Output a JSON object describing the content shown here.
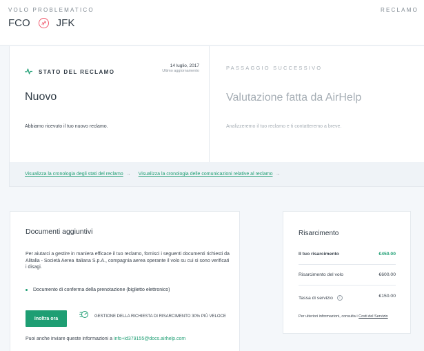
{
  "header": {
    "eyebrow": "VOLO PROBLEMATICO",
    "right_label": "RECLAMO",
    "origin": "FCO",
    "destination": "JFK"
  },
  "status": {
    "label": "STATO DEL RECLAMO",
    "date": "14 luglio, 2017",
    "date_sub": "Ultimo aggiornamento",
    "title": "Nuovo",
    "description": "Abbiamo ricevuto il tuo nuovo reclamo."
  },
  "next_step": {
    "label": "PASSAGGIO SUCCESSIVO",
    "title": "Valutazione fatta da AirHelp",
    "description": "Analizzeremo il tuo reclamo e ti contatteremo a breve."
  },
  "links": {
    "status_history": "Visualizza la cronologia degli stati del reclamo",
    "comm_history": "Visualizza la cronologia delle comunicazioni relative al reclamo",
    "arrow": "→"
  },
  "documents": {
    "title": "Documenti aggiuntivi",
    "intro": "Per aiutarci a gestire in maniera efficace il tuo reclamo, fornisci i seguenti documenti richiesti da Alitalia - Società Aerea Italiana S.p.A., compagnia aerea operante il volo su cui si sono verificati i disagi.",
    "bullet": "Documento di conferma della prenotazione (biglietto elettronico)",
    "button": "Inoltra ora",
    "speed_text": "GESTIONE DELLA RICHIESTA DI RISARCIMENTO 30% PIÙ VELOCE",
    "contact_prefix": "Puoi anche inviare queste informazioni a ",
    "contact_email": "info+id379155@docs.airhelp.com"
  },
  "refund": {
    "title": "Risarcimento",
    "rows": [
      {
        "label": "Il tuo risarcimento",
        "value": "€450.00"
      },
      {
        "label": "Risarcimento del volo",
        "value": "€600.00"
      },
      {
        "label": "Tassa di servizio",
        "value": "€150.00"
      }
    ],
    "note_prefix": "Per ulteriori informazioni, consulta i ",
    "note_link": "Costi del Servizio"
  },
  "colors": {
    "accent": "#1e9e73",
    "plane": "#f05a6e"
  }
}
